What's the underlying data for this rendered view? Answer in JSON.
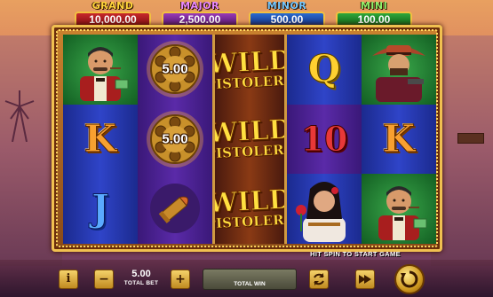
{
  "jackpots": {
    "grand": {
      "label": "GRAND",
      "value": "10,000.00"
    },
    "major": {
      "label": "MAJOR",
      "value": "2,500.00"
    },
    "minor": {
      "label": "MINOR",
      "value": "500.00"
    },
    "mini": {
      "label": "MINI",
      "value": "100.00"
    }
  },
  "reels": {
    "row1": {
      "c1": {
        "symbol": "bandit-man-icon"
      },
      "c2": {
        "symbol": "revolver-cylinder-icon",
        "value": "5.00"
      },
      "c3": {
        "symbol": "wild-icon",
        "word": "WILD",
        "sub": "PISTOLERO"
      },
      "c4": {
        "symbol": "Q"
      },
      "c5": {
        "symbol": "gunslinger-icon"
      }
    },
    "row2": {
      "c1": {
        "symbol": "K"
      },
      "c2": {
        "symbol": "revolver-cylinder-icon",
        "value": "5.00"
      },
      "c3": {
        "symbol": "wild-icon",
        "word": "WILD",
        "sub": "PISTOLERO"
      },
      "c4": {
        "symbol": "10"
      },
      "c5": {
        "symbol": "K"
      }
    },
    "row3": {
      "c1": {
        "symbol": "J"
      },
      "c2": {
        "symbol": "bullet-icon"
      },
      "c3": {
        "symbol": "wild-icon",
        "word": "WILD",
        "sub": "PISTOLERO"
      },
      "c4": {
        "symbol": "senorita-icon"
      },
      "c5": {
        "symbol": "bandit-man-icon"
      }
    }
  },
  "hint": "HIT SPIN TO START GAME",
  "controls": {
    "bet_value": "5.00",
    "bet_label": "TOTAL BET",
    "win_label": "TOTAL WIN",
    "info": "i",
    "minus": "−",
    "plus": "+"
  },
  "colors": {
    "gold": "#f0c050",
    "grand": "#c8282a",
    "major": "#9a3ab6",
    "minor": "#2a6ad0",
    "mini": "#2ea83a"
  }
}
